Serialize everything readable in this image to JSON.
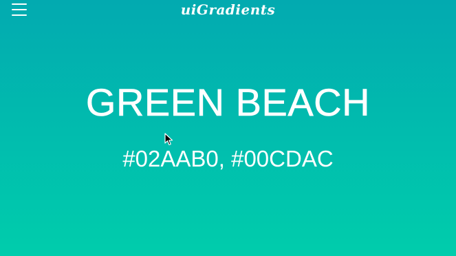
{
  "header": {
    "logo_text": "uiGradients",
    "menu_icon": "hamburger-menu-icon"
  },
  "gradient": {
    "name": "GREEN BEACH",
    "codes_text": "#02AAB0, #00CDAC",
    "color_start": "#02AAB0",
    "color_end": "#00CDAC"
  },
  "cursor_icon": "mouse-pointer-icon"
}
